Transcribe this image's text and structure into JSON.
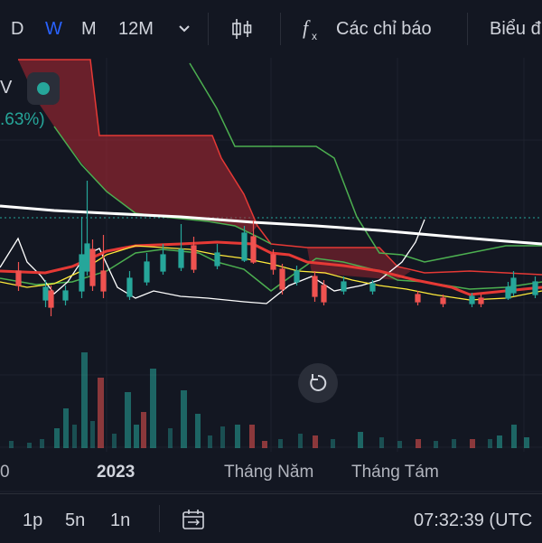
{
  "toolbar": {
    "intervals": [
      "D",
      "W",
      "M",
      "12M"
    ],
    "active_interval": "W",
    "indicators_label": "Các chỉ báo",
    "chart_type_label": "Biểu đ"
  },
  "legend": {
    "symbol_fragment": "V",
    "change_fragment": ".63%)"
  },
  "time_axis": {
    "labels": [
      "0",
      "2023",
      "Tháng Năm",
      "Tháng Tám"
    ]
  },
  "bottom_bar": {
    "ranges": [
      "1p",
      "5n",
      "1n"
    ],
    "clock": "07:32:39 (UTC"
  },
  "colors": {
    "up": "#26a69a",
    "down": "#ef5350",
    "cloud_bear": "#b22833",
    "ema_long": "#ffffff",
    "kijun": "#e53935",
    "senkou_b": "#4caf50",
    "tenkan": "#ffeb3b"
  }
}
